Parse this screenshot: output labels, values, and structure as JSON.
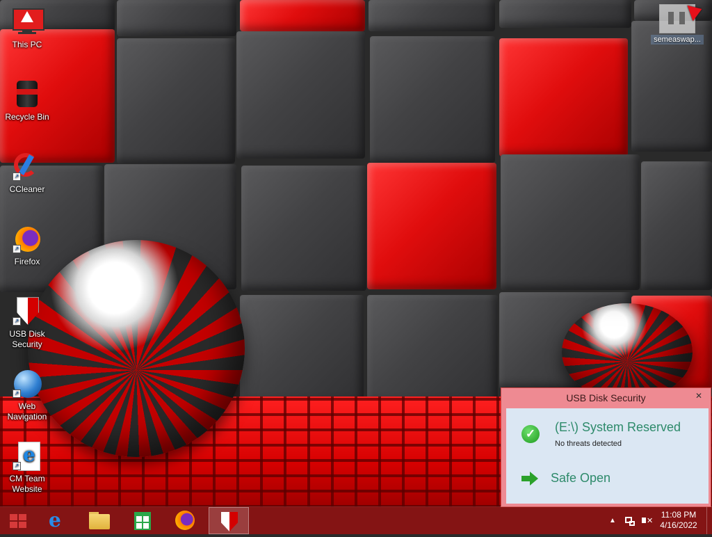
{
  "desktop": {
    "icons": [
      {
        "label": "This PC",
        "icon": "this-pc-icon"
      },
      {
        "label": "Recycle Bin",
        "icon": "recycle-bin-icon"
      },
      {
        "label": "CCleaner",
        "icon": "ccleaner-icon"
      },
      {
        "label": "Firefox",
        "icon": "firefox-icon"
      },
      {
        "label": "USB Disk Security",
        "icon": "usb-disk-security-icon"
      },
      {
        "label": "Web Navigation",
        "icon": "web-navigation-icon"
      },
      {
        "label": "CM Team Website",
        "icon": "cm-team-website-icon"
      }
    ],
    "corner_item": {
      "label": "semeaswap...",
      "icon": "app-thumbnail-icon"
    }
  },
  "popup": {
    "title": "USB Disk Security",
    "close_label": "✕",
    "drive_label": "(E:\\) System Reserved",
    "status_text": "No threats detected",
    "action_label": "Safe Open",
    "accent_color": "#2d8a6a"
  },
  "taskbar": {
    "buttons": [
      {
        "name": "start",
        "icon": "windows-logo-icon"
      },
      {
        "name": "internet-explorer",
        "icon": "internet-explorer-icon"
      },
      {
        "name": "file-explorer",
        "icon": "folder-icon"
      },
      {
        "name": "store",
        "icon": "store-icon"
      },
      {
        "name": "firefox",
        "icon": "firefox-icon"
      },
      {
        "name": "usb-disk-security",
        "icon": "shield-icon",
        "active": true
      }
    ],
    "tray": {
      "chevron": "▲",
      "volume_mark": "✕",
      "time": "11:08 PM",
      "date": "4/16/2022"
    }
  },
  "colors": {
    "taskbar": "#8c1212",
    "popup_frame": "#ee8a92",
    "popup_body": "#dbe7f3"
  }
}
